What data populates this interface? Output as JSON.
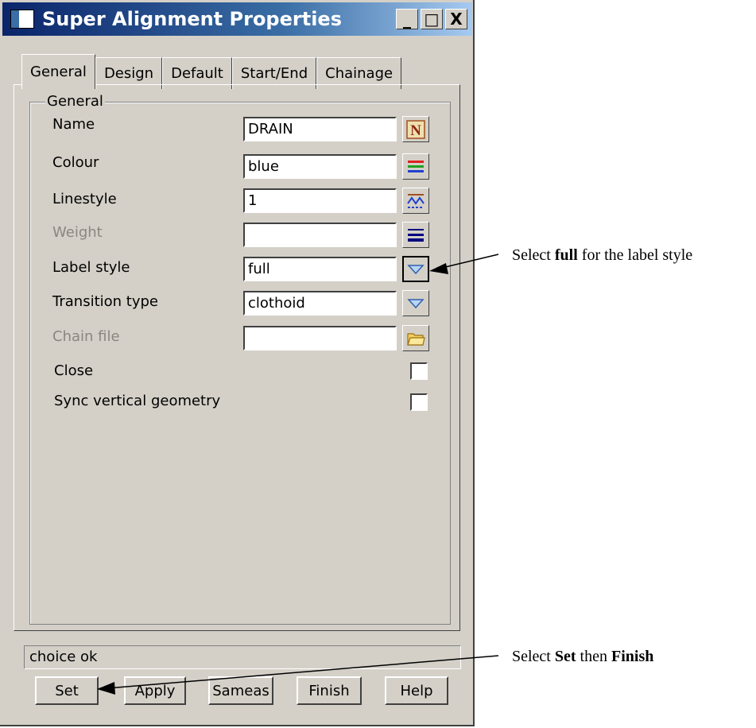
{
  "window": {
    "title": "Super Alignment Properties",
    "controls": [
      "_",
      "□",
      "X"
    ]
  },
  "tabs": [
    "General",
    "Design",
    "Default",
    "Start/End",
    "Chainage"
  ],
  "active_tab": "General",
  "group": {
    "legend": "General",
    "fields": {
      "name": {
        "label": "Name",
        "value": "DRAIN",
        "icon": "name-N-icon"
      },
      "colour": {
        "label": "Colour",
        "value": "blue",
        "icon": "colour-lines-icon"
      },
      "linestyle": {
        "label": "Linestyle",
        "value": "1",
        "icon": "linestyle-icon"
      },
      "weight": {
        "label": "Weight",
        "value": "",
        "icon": "weight-lines-icon"
      },
      "label_style": {
        "label": "Label style",
        "value": "full",
        "icon": "chevron-down-icon"
      },
      "transition_type": {
        "label": "Transition type",
        "value": "clothoid",
        "icon": "chevron-down-icon"
      },
      "chain_file": {
        "label": "Chain file",
        "value": "",
        "icon": "folder-icon"
      }
    },
    "checkboxes": {
      "close": {
        "label": "Close",
        "checked": false
      },
      "sync_vertical": {
        "label": "Sync vertical geometry",
        "checked": false
      }
    }
  },
  "status_text": "choice ok",
  "buttons": {
    "set": "Set",
    "apply": "Apply",
    "sameas": "Sameas",
    "finish": "Finish",
    "help": "Help"
  },
  "annotations": {
    "label_style": {
      "prefix": "Select ",
      "bold": "full",
      "suffix": " for the label style"
    },
    "set_finish": {
      "prefix": "Select ",
      "bold1": "Set",
      "middle": " then ",
      "bold2": "Finish"
    }
  },
  "colors": {
    "titlebar_start": "#0a246a",
    "titlebar_end": "#a6caf0",
    "dialog_bg": "#d4d0c8"
  }
}
